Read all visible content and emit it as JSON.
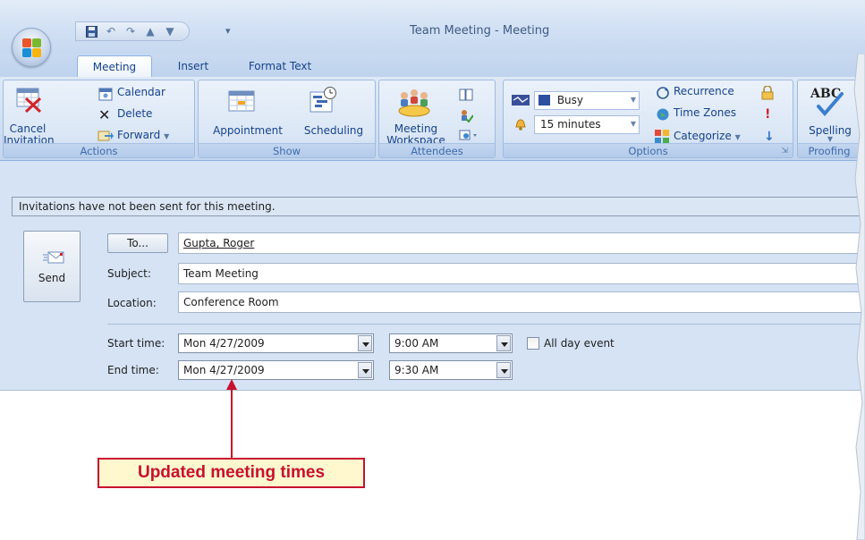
{
  "window": {
    "title": "Team Meeting - Meeting"
  },
  "tabs": [
    {
      "label": "Meeting",
      "active": true
    },
    {
      "label": "Insert",
      "active": false
    },
    {
      "label": "Format Text",
      "active": false
    }
  ],
  "ribbon": {
    "actions": {
      "label": "Actions",
      "cancel_invitation": [
        "Cancel",
        "Invitation"
      ],
      "calendar": "Calendar",
      "delete": "Delete",
      "forward": "Forward"
    },
    "show": {
      "label": "Show",
      "appointment": "Appointment",
      "scheduling": "Scheduling"
    },
    "attendees": {
      "label": "Attendees",
      "meeting_workspace": [
        "Meeting",
        "Workspace"
      ]
    },
    "options": {
      "label": "Options",
      "show_as": "Busy",
      "reminder": "15 minutes",
      "recurrence": "Recurrence",
      "time_zones": "Time Zones",
      "categorize": "Categorize"
    },
    "proofing": {
      "label": "Proofing",
      "spelling": "Spelling"
    }
  },
  "form": {
    "info_bar": "Invitations have not been sent for this meeting.",
    "send": "Send",
    "to_button": "To...",
    "to_value": "Gupta, Roger",
    "subject_label": "Subject:",
    "subject_value": "Team Meeting",
    "location_label": "Location:",
    "location_value": "Conference Room",
    "start_label": "Start time:",
    "start_date": "Mon 4/27/2009",
    "start_time": "9:00 AM",
    "all_day_label": "All day event",
    "all_day_checked": false,
    "end_label": "End time:",
    "end_date": "Mon 4/27/2009",
    "end_time": "9:30 AM"
  },
  "callout": "Updated meeting times",
  "colors": {
    "callout_red": "#c8102e",
    "callout_fill": "#fff8cf",
    "ribbon_blue": "#d0dff2",
    "appointment_active": "#f8b94d"
  }
}
